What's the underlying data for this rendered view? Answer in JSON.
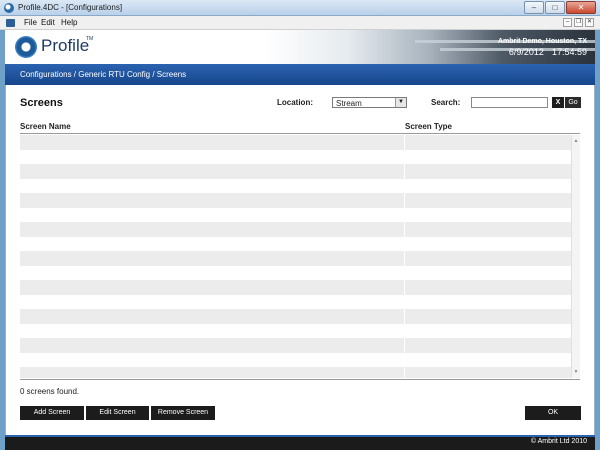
{
  "window": {
    "title": "Profile.4DC - [Configurations]",
    "minimize_glyph": "‒",
    "maximize_glyph": "□",
    "close_glyph": "✕"
  },
  "menubar": {
    "items": [
      "File",
      "Edit",
      "Help"
    ],
    "mdi_minimize": "‒",
    "mdi_restore": "❐",
    "mdi_close": "✕"
  },
  "banner": {
    "logo_text": "Profile",
    "logo_tm": "TM",
    "site": "Ambrit Demo, Houston, TX",
    "date": "6/9/2012",
    "time": "17:54:59"
  },
  "breadcrumb": "Configurations / Generic RTU Config / Screens",
  "page": {
    "title": "Screens",
    "location_label": "Location:",
    "location_value": "Stream",
    "search_label": "Search:",
    "search_value": "",
    "clear_label": "X",
    "go_label": "Go"
  },
  "table": {
    "columns": [
      "Screen Name",
      "Screen Type"
    ],
    "rows": []
  },
  "status_text": "0 screens found.",
  "buttons": {
    "add": "Add Screen",
    "edit": "Edit Screen",
    "remove": "Remove Screen",
    "ok": "OK"
  },
  "footer": {
    "copyright": "© Ambrit Ltd 2010"
  },
  "colors": {
    "accent_blue": "#17468b",
    "button_dark": "#1c1c1c"
  }
}
